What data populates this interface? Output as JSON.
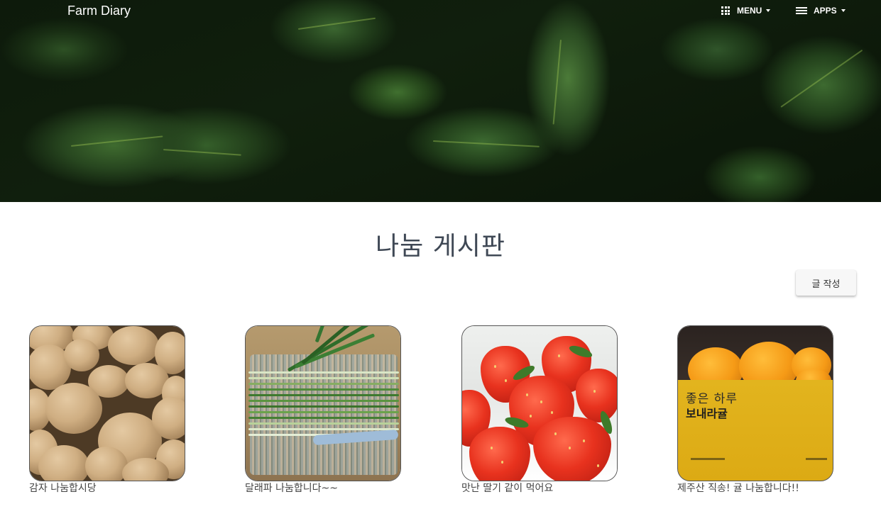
{
  "navbar": {
    "brand": "Farm Diary",
    "menu_label": "MENU",
    "apps_label": "APPS"
  },
  "page": {
    "title": "나눔 게시판",
    "write_button": "글 작성"
  },
  "posts": [
    {
      "caption": "감자 나눔합시당",
      "image": "potatoes-photo"
    },
    {
      "caption": "달래파 나눔합니다~~",
      "image": "green-onions-photo"
    },
    {
      "caption": "맛난 딸기 같이 먹어요",
      "image": "strawberries-photo"
    },
    {
      "caption": "제주산 직송! 귤 나눔합니다!!",
      "image": "tangerines-box-photo"
    }
  ],
  "tangerine_box": {
    "line1": "좋은 하루",
    "line2": "보내라귤"
  },
  "colors": {
    "hero_dark": "#0d1a0b",
    "title": "#3f4855",
    "button_bg": "#f7f7f7"
  }
}
